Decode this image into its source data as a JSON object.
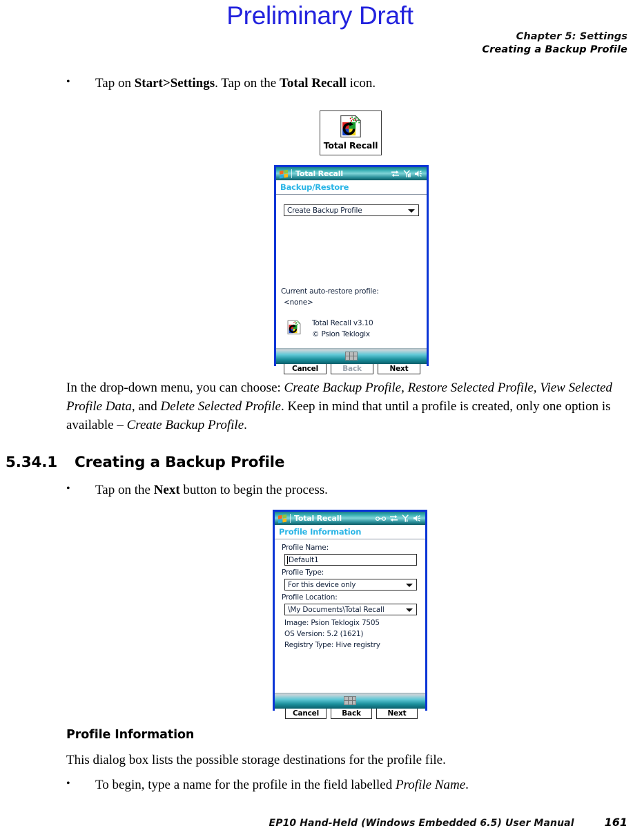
{
  "watermark": "Preliminary Draft",
  "running_head": {
    "line1": "Chapter 5:  Settings",
    "line2": "Creating a Backup Profile"
  },
  "bullet1": {
    "marker": "•",
    "part1": "Tap on ",
    "bold1": "Start>Settings",
    "part2": ". Tap on the ",
    "bold2": "Total Recall",
    "part3": " icon."
  },
  "desktop_icon": {
    "caption": "Total Recall",
    "icon": "total-recall-icon"
  },
  "dialog1": {
    "title": "Total Recall",
    "subtitle": "Backup/Restore",
    "combo_value": "Create Backup Profile",
    "auto_restore_label": "Current auto-restore profile:",
    "auto_restore_value": "<none>",
    "about_line1": "Total Recall v3.10",
    "about_line2": "© Psion Teklogix",
    "buttons": [
      {
        "label": "Cancel",
        "disabled": false
      },
      {
        "label": "Back",
        "disabled": true
      },
      {
        "label": "Next",
        "disabled": false
      }
    ],
    "tray_icons": [
      "connectivity-icon",
      "signal-icon",
      "volume-icon"
    ]
  },
  "paragraph1": {
    "t1": "In the drop-down menu, you can choose: ",
    "i1": "Create Backup Profile, Restore Selected Profile, View Selected Profile Data",
    "t2": ", and ",
    "i2": "Delete Selected Profile",
    "t3": ". Keep in mind that until a profile is created, only one option is available – ",
    "i3": "Create Backup Profile",
    "t4": "."
  },
  "heading": {
    "number": "5.34.1",
    "title": "Creating a Backup Profile"
  },
  "bullet2": {
    "marker": "•",
    "part1": "Tap on the ",
    "bold1": "Next",
    "part2": " button to begin the process."
  },
  "dialog2": {
    "title": "Total Recall",
    "subtitle": "Profile Information",
    "profile_name_label": "Profile Name:",
    "profile_name_value": "Default1",
    "profile_type_label": "Profile Type:",
    "profile_type_value": "For this device only",
    "profile_location_label": "Profile Location:",
    "profile_location_value": "\\My Documents\\Total Recall",
    "info_lines": [
      "Image: Psion Teklogix 7505",
      "OS Version: 5.2 (1621)",
      "Registry Type: Hive registry"
    ],
    "buttons": [
      {
        "label": "Cancel",
        "disabled": false
      },
      {
        "label": "Back",
        "disabled": false
      },
      {
        "label": "Next",
        "disabled": false
      }
    ],
    "tray_icons": [
      "headset-icon",
      "connectivity-icon",
      "signal-icon",
      "volume-icon"
    ]
  },
  "subheading": "Profile Information",
  "paragraph2": "This dialog box lists the possible storage destinations for the profile file.",
  "bullet3": {
    "marker": "•",
    "part1": "To begin, type a name for the profile in the field labelled ",
    "i1": "Profile Name",
    "part2": "."
  },
  "footer": {
    "text": "EP10 Hand-Held (Windows Embedded 6.5) User Manual",
    "page": "161"
  },
  "colors": {
    "watermark": "#2222dd",
    "dialog_border": "#0b35d6",
    "subtitle_text": "#2ab5e6"
  }
}
